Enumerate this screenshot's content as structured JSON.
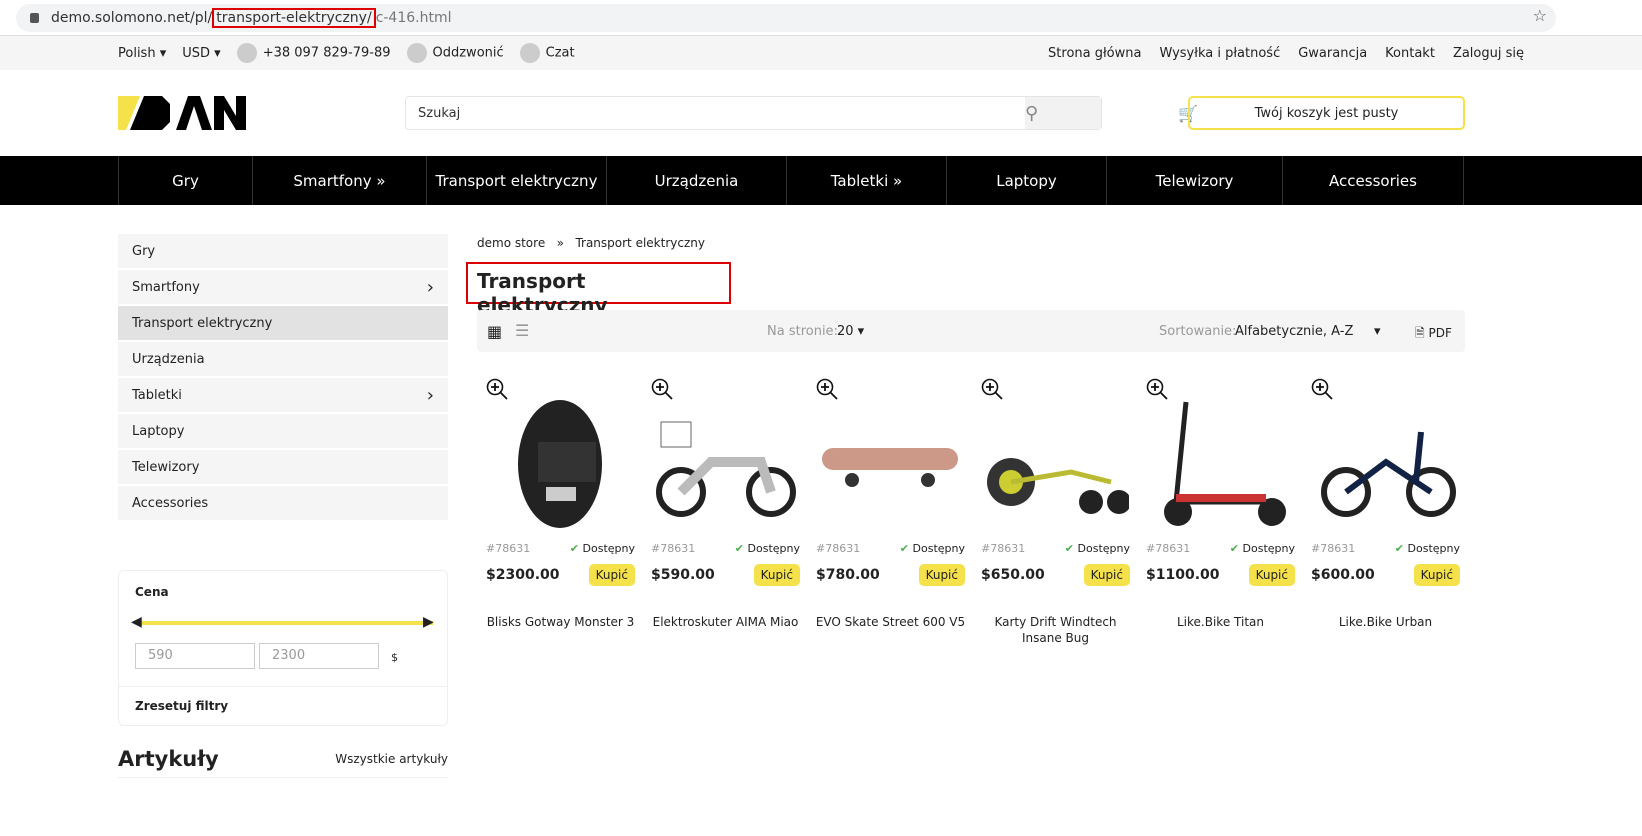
{
  "browser": {
    "url_pre": "demo.solomono.net/pl/",
    "url_hl": "transport-elektryczny/",
    "url_post": "c-416.html"
  },
  "topbar": {
    "language": "Polish",
    "currency": "USD",
    "phone": "+38 097 829-79-89",
    "callback": "Oddzwonić",
    "chat": "Czat",
    "links": [
      "Strona główna",
      "Wysyłka i płatność",
      "Gwarancja",
      "Kontakt",
      "Zaloguj się"
    ]
  },
  "header": {
    "logo": "DAN",
    "search_placeholder": "Szukaj",
    "cart": "Twój koszyk jest pusty"
  },
  "nav": [
    {
      "label": "Gry",
      "w": 134
    },
    {
      "label": "Smartfony »",
      "w": 174
    },
    {
      "label": "Transport elektryczny",
      "w": 180
    },
    {
      "label": "Urządzenia",
      "w": 180
    },
    {
      "label": "Tabletki »",
      "w": 160
    },
    {
      "label": "Laptopy",
      "w": 160
    },
    {
      "label": "Telewizory",
      "w": 176
    },
    {
      "label": "Accessories",
      "w": 182
    }
  ],
  "sidebar": [
    {
      "label": "Gry"
    },
    {
      "label": "Smartfony",
      "arrow": true
    },
    {
      "label": "Transport elektryczny",
      "active": true
    },
    {
      "label": "Urządzenia"
    },
    {
      "label": "Tabletki",
      "arrow": true
    },
    {
      "label": "Laptopy"
    },
    {
      "label": "Telewizory"
    },
    {
      "label": "Accessories"
    }
  ],
  "filter": {
    "title": "Cena",
    "min": "590",
    "max": "2300",
    "unit": "$",
    "reset": "Zresetuj filtry"
  },
  "articles": {
    "title": "Artykuły",
    "all": "Wszystkie artykuły"
  },
  "breadcrumb": {
    "home": "demo store",
    "sep": "»",
    "current": "Transport elektryczny"
  },
  "page_title": "Transport elektryczny",
  "toolbar": {
    "per_page_label": "Na stronie:",
    "per_page": "20",
    "sort_label": "Sortowanie:",
    "sort": "Alfabetycznie, A-Z",
    "pdf": "PDF"
  },
  "products": [
    {
      "sku": "#78631",
      "status": "Dostępny",
      "price": "$2300.00",
      "buy": "Kupić",
      "name": "Blisks Gotway Monster 3"
    },
    {
      "sku": "#78631",
      "status": "Dostępny",
      "price": "$590.00",
      "buy": "Kupić",
      "name": "Elektroskuter AIMA Miao"
    },
    {
      "sku": "#78631",
      "status": "Dostępny",
      "price": "$780.00",
      "buy": "Kupić",
      "name": "EVO Skate Street 600 V5"
    },
    {
      "sku": "#78631",
      "status": "Dostępny",
      "price": "$650.00",
      "buy": "Kupić",
      "name": "Karty Drift Windtech Insane Bug"
    },
    {
      "sku": "#78631",
      "status": "Dostępny",
      "price": "$1100.00",
      "buy": "Kupić",
      "name": "Like.Bike Titan"
    },
    {
      "sku": "#78631",
      "status": "Dostępny",
      "price": "$600.00",
      "buy": "Kupić",
      "name": "Like.Bike Urban"
    }
  ],
  "colors": {
    "accent": "#f5e14a",
    "highlight": "#dd0000",
    "available": "#4caf50"
  }
}
